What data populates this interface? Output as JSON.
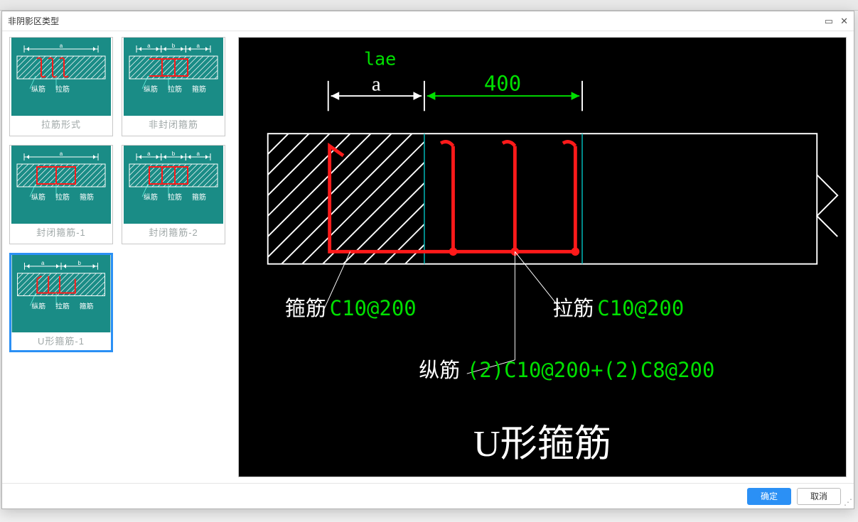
{
  "dialog": {
    "title": "非阴影区类型",
    "maximize_tip": "maximize",
    "close_tip": "close"
  },
  "thumbs": [
    {
      "id": "t1",
      "label": "拉筋形式",
      "dim_row": [
        "a"
      ],
      "sub_labels": [
        "纵筋",
        "拉筋"
      ],
      "pattern": "ties"
    },
    {
      "id": "t2",
      "label": "非封闭箍筋",
      "dim_row": [
        "a",
        "b",
        "a"
      ],
      "sub_labels": [
        "纵筋",
        "拉筋",
        "箍筋"
      ],
      "pattern": "u-open"
    },
    {
      "id": "t3",
      "label": "封闭箍筋-1",
      "dim_row": [
        "a"
      ],
      "sub_labels": [
        "纵筋",
        "拉筋",
        "箍筋"
      ],
      "pattern": "closed1"
    },
    {
      "id": "t4",
      "label": "封闭箍筋-2",
      "dim_row": [
        "a",
        "b",
        "a"
      ],
      "sub_labels": [
        "纵筋",
        "拉筋",
        "箍筋"
      ],
      "pattern": "closed2"
    },
    {
      "id": "t5",
      "label": "U形箍筋-1",
      "dim_row": [
        "a",
        "b"
      ],
      "sub_labels": [
        "纵筋",
        "拉筋",
        "箍筋"
      ],
      "pattern": "u1",
      "selected": true
    }
  ],
  "preview": {
    "colors": {
      "green": "#00e000",
      "red": "#ff1a1a",
      "cyan": "#00bcbc",
      "white": "#ffffff"
    },
    "dim_lae": "lae",
    "dim_a": "a",
    "dim_400": "400",
    "label_guijin_name": "箍筋",
    "label_guijin_val": "C10@200",
    "label_lajin_name": "拉筋",
    "label_lajin_val": "C10@200",
    "label_zongjin_name": "纵筋",
    "label_zongjin_val": "(2)C10@200+(2)C8@200",
    "big_title": "U形箍筋"
  },
  "buttons": {
    "ok": "确定",
    "cancel": "取消"
  }
}
